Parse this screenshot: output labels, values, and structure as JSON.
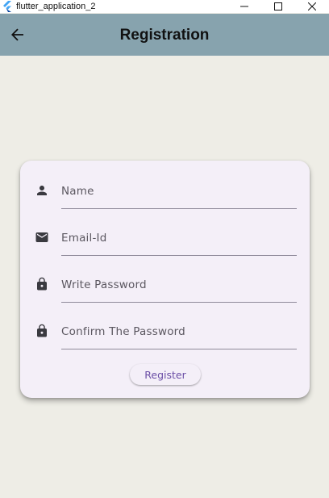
{
  "window": {
    "title": "flutter_application_2",
    "icons": {
      "app": "flutter-logo-icon",
      "minimize": "minimize-icon",
      "maximize": "maximize-icon",
      "close": "close-icon"
    }
  },
  "appbar": {
    "title": "Registration",
    "back_icon": "arrow-back-icon",
    "color": "#87a3ae"
  },
  "form": {
    "fields": [
      {
        "icon": "person-icon",
        "placeholder": "Name",
        "value": ""
      },
      {
        "icon": "email-icon",
        "placeholder": "Email-Id",
        "value": ""
      },
      {
        "icon": "lock-icon",
        "placeholder": "Write Password",
        "value": ""
      },
      {
        "icon": "lock-icon",
        "placeholder": "Confirm The Password",
        "value": ""
      }
    ],
    "register_label": "Register",
    "accent_color": "#6b4fa6",
    "card_color": "#f4eff8"
  },
  "background_color": "#eeede6"
}
